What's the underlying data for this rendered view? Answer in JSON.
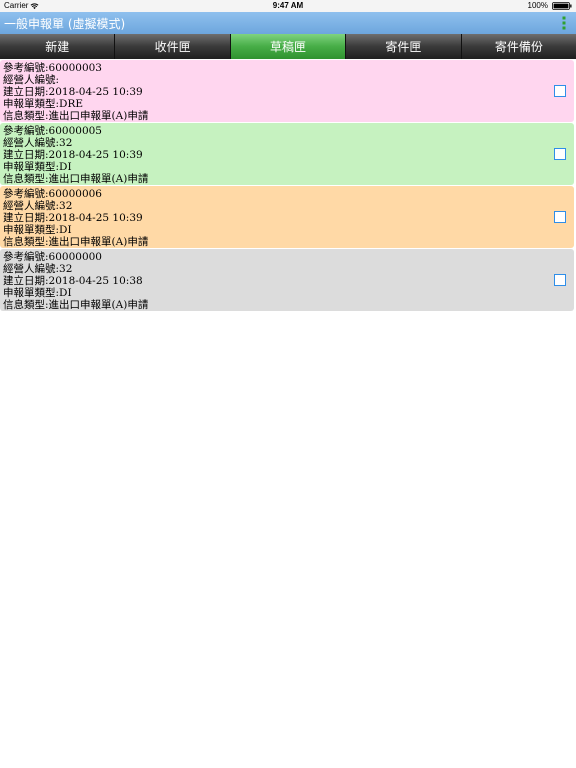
{
  "status_bar": {
    "carrier": "Carrier",
    "time": "9:47 AM",
    "battery": "100%"
  },
  "header": {
    "title": "一般申報單 (虛擬模式)"
  },
  "tabs": [
    {
      "label": "新建",
      "active": false
    },
    {
      "label": "收件匣",
      "active": false
    },
    {
      "label": "草稿匣",
      "active": true
    },
    {
      "label": "寄件匣",
      "active": false
    },
    {
      "label": "寄件備份",
      "active": false
    }
  ],
  "colors": {
    "card_pink": "#ffd6ef",
    "card_green": "#c6f2c0",
    "card_orange": "#ffd9a6",
    "card_gray": "#dcdcdc",
    "checkbox_border": "#2e8ee8",
    "tab_active": "#47ad47"
  },
  "records": [
    {
      "ref": "參考編號:60000003",
      "operator": "經營人編號:",
      "created": "建立日期:2018-04-25 10:39",
      "decl_type": "申報單類型:DRE",
      "msg_type": "信息類型:進出口申報單(A)申請",
      "color": "#ffd6ef"
    },
    {
      "ref": "參考編號:60000005",
      "operator": "經營人編號:32",
      "created": "建立日期:2018-04-25 10:39",
      "decl_type": "申報單類型:DI",
      "msg_type": "信息類型:進出口申報單(A)申請",
      "color": "#c6f2c0"
    },
    {
      "ref": "參考編號:60000006",
      "operator": "經營人編號:32",
      "created": "建立日期:2018-04-25 10:39",
      "decl_type": "申報單類型:DI",
      "msg_type": "信息類型:進出口申報單(A)申請",
      "color": "#ffd9a6"
    },
    {
      "ref": "參考編號:60000000",
      "operator": "經營人編號:32",
      "created": "建立日期:2018-04-25 10:38",
      "decl_type": "申報單類型:DI",
      "msg_type": "信息類型:進出口申報單(A)申請",
      "color": "#dcdcdc"
    }
  ]
}
